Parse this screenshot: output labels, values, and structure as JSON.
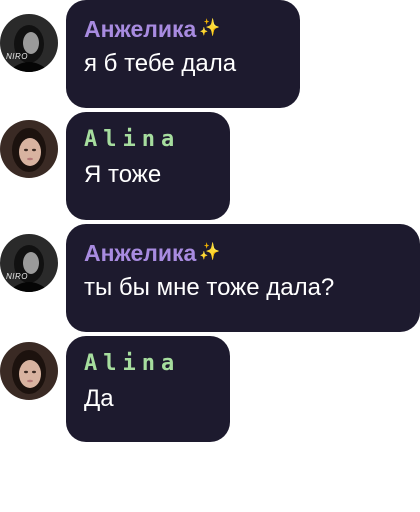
{
  "colors": {
    "bubble": "#1d1a2e",
    "name_angelika": "#a88be0",
    "name_alina": "#a6dd9e",
    "text": "#ffffff",
    "sparkle": "#f3d04e"
  },
  "messages": [
    {
      "sender": "Анжелика",
      "sparkle": "✨",
      "text": "я б тебе дала",
      "avatar_caption": "NIRO"
    },
    {
      "sender": "Alina",
      "text": "Я тоже"
    },
    {
      "sender": "Анжелика",
      "sparkle": "✨",
      "text": "ты бы мне тоже дала?",
      "avatar_caption": "NIRO"
    },
    {
      "sender": "Alina",
      "text": "Да"
    }
  ]
}
